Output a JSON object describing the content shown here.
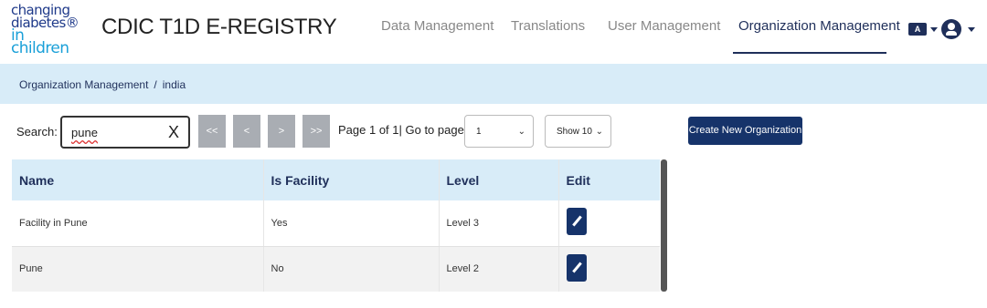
{
  "brand": {
    "logo_line1": "changing",
    "logo_line2": "diabetes®",
    "logo_line3": "in children"
  },
  "app_title": "CDIC T1D E-REGISTRY",
  "nav": {
    "data_management": "Data Management",
    "translations": "Translations",
    "user_management": "User Management",
    "organization_management": "Organization Management"
  },
  "toolbar_icons": {
    "language": "language-icon",
    "user": "user-icon"
  },
  "breadcrumb": {
    "root": "Organization Management",
    "separator": "/",
    "current": "india"
  },
  "search": {
    "label": "Search:",
    "value": "pune",
    "clear": "X"
  },
  "pagination": {
    "first": "<<",
    "prev": "<",
    "next": ">",
    "last": ">>",
    "info": "Page 1 of 1| Go to page:",
    "page_value": "1",
    "show_value": "Show 10"
  },
  "create_button": "Create New Organization",
  "table": {
    "headers": [
      "Name",
      "Is Facility",
      "Level",
      "Edit"
    ],
    "rows": [
      {
        "name": "Facility in Pune",
        "is_facility": "Yes",
        "level": "Level 3"
      },
      {
        "name": "Pune",
        "is_facility": "No",
        "level": "Level 2"
      }
    ]
  },
  "colors": {
    "primary": "#16336a",
    "header_bg": "#d8ecf8",
    "pager_btn": "#a9adb3"
  }
}
